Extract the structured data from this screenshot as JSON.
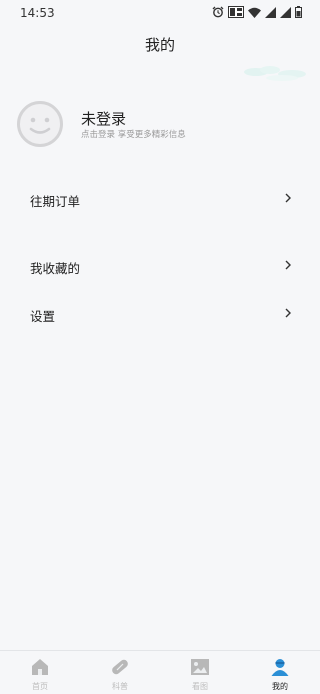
{
  "status": {
    "time": "14:53"
  },
  "header": {
    "title": "我的"
  },
  "profile": {
    "name": "未登录",
    "subtitle": "点击登录 享受更多精彩信息"
  },
  "menu": {
    "orders": "往期订单",
    "favorites": "我收藏的",
    "settings": "设置"
  },
  "tabs": [
    {
      "label": "首页",
      "icon": "home-icon"
    },
    {
      "label": "科普",
      "icon": "capsule-icon"
    },
    {
      "label": "看图",
      "icon": "image-icon"
    },
    {
      "label": "我的",
      "icon": "user-icon"
    }
  ],
  "colors": {
    "background": "#f6f7f9",
    "accent": "#2b8fd6",
    "inactive": "#bdbdbd"
  }
}
